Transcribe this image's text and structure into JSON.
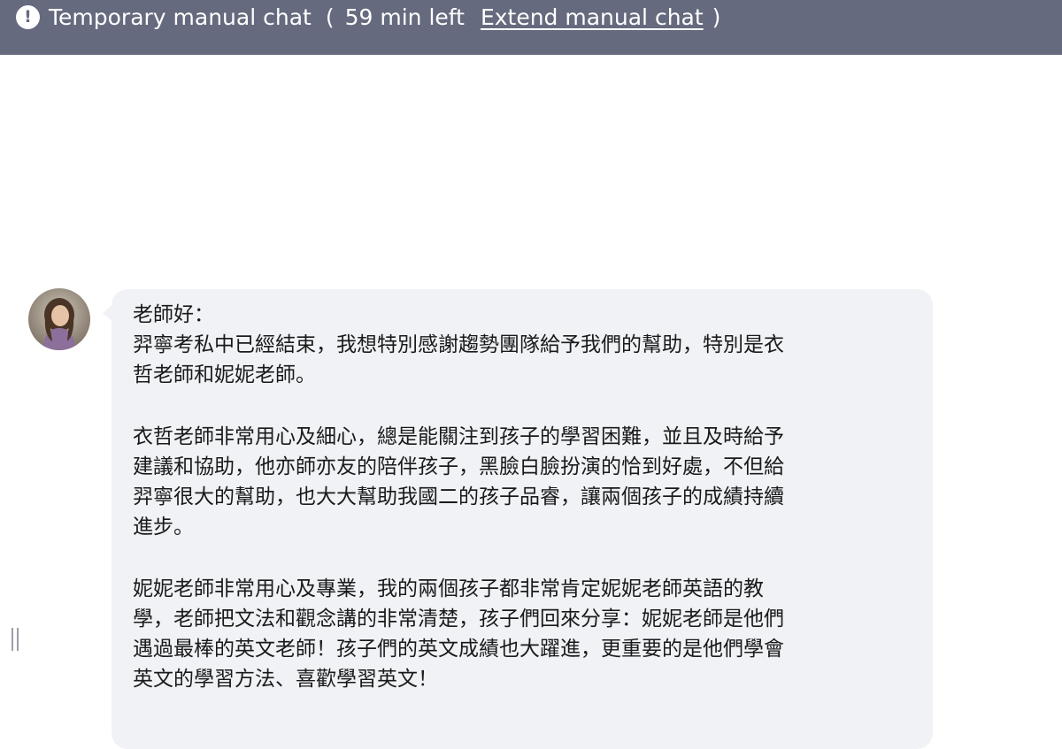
{
  "banner": {
    "icon": "alert-circle-icon",
    "title": "Temporary manual chat",
    "open_paren": "(",
    "time_left": "59 min left",
    "extend_link": "Extend manual chat",
    "close_paren": ")",
    "background": "#656a7e"
  },
  "message": {
    "avatar": "user-avatar-photo",
    "bubble_color": "#f0f2f5",
    "lines": [
      "老師好：",
      "羿寧考私中已經結束，我想特別感謝趨勢團隊給予我們的幫助，特別是衣",
      "哲老師和妮妮老師。",
      "衣哲老師非常用心及細心，總是能關注到孩子的學習困難，並且及時給予",
      "建議和協助，他亦師亦友的陪伴孩子，黑臉白臉扮演的恰到好處，不但給",
      "羿寧很大的幫助，也大大幫助我國二的孩子品睿，讓兩個孩子的成績持續",
      "進步。",
      "妮妮老師非常用心及專業，我的兩個孩子都非常肯定妮妮老師英語的教",
      "學，老師把文法和觀念講的非常清楚，孩子們回來分享：妮妮老師是他們",
      "遇過最棒的英文老師！孩子們的英文成績也大躍進，更重要的是他們學會",
      "英文的學習方法、喜歡學習英文！"
    ]
  }
}
